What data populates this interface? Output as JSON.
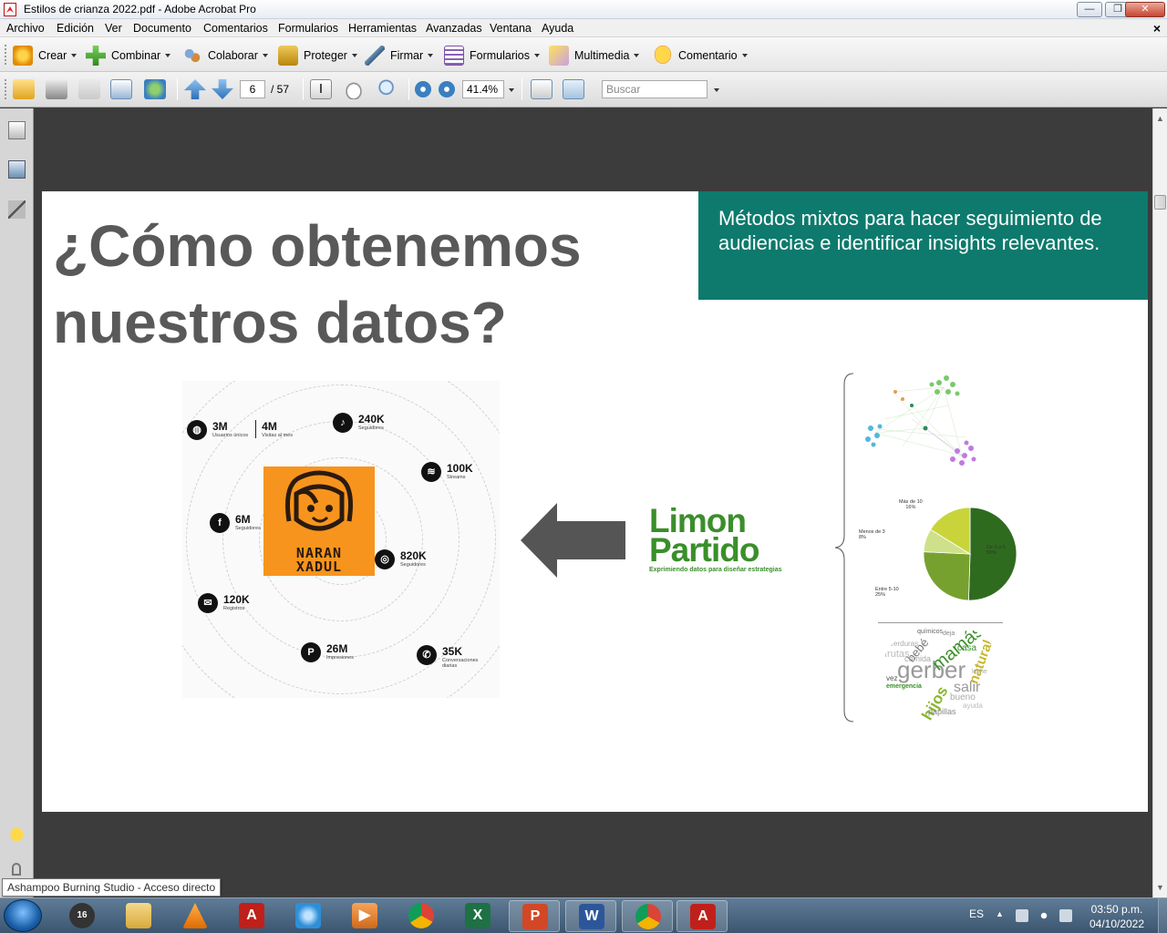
{
  "window": {
    "title": "Estilos de crianza 2022.pdf - Adobe Acrobat Pro",
    "controls": [
      "minimize",
      "restore",
      "close"
    ]
  },
  "menubar": {
    "items": [
      "Archivo",
      "Edición",
      "Ver",
      "Documento",
      "Comentarios",
      "Formularios",
      "Herramientas",
      "Avanzadas",
      "Ventana",
      "Ayuda"
    ],
    "close_glyph": "×"
  },
  "toolbar1": {
    "buttons": [
      {
        "label": "Crear",
        "icon": "create-icon"
      },
      {
        "label": "Combinar",
        "icon": "combine-icon"
      },
      {
        "label": "Colaborar",
        "icon": "collaborate-icon"
      },
      {
        "label": "Proteger",
        "icon": "lock-icon"
      },
      {
        "label": "Firmar",
        "icon": "pen-icon"
      },
      {
        "label": "Formularios",
        "icon": "form-icon"
      },
      {
        "label": "Multimedia",
        "icon": "multimedia-icon"
      },
      {
        "label": "Comentario",
        "icon": "comment-icon"
      }
    ]
  },
  "toolbar2": {
    "page_current": "6",
    "page_total": "/ 57",
    "zoom": "41.4%",
    "search_placeholder": "Buscar"
  },
  "slide": {
    "title": "¿Cómo obtenemos nuestros datos?",
    "callout": "Métodos mixtos para  hacer seguimiento de audiencias e identificar insights relevantes.",
    "brand_name_line1": "NARAN",
    "brand_name_line2": "XADUL",
    "stats": [
      {
        "icon": "globe-icon",
        "value": "3M",
        "label": "Usuarios únicos",
        "value2": "4M",
        "label2": "Visitas al mes"
      },
      {
        "icon": "tiktok-icon",
        "value": "240K",
        "label": "Seguidores"
      },
      {
        "icon": "spotify-icon",
        "value": "100K",
        "label": "Streams"
      },
      {
        "icon": "facebook-icon",
        "value": "6M",
        "label": "Seguidores"
      },
      {
        "icon": "instagram-icon",
        "value": "820K",
        "label": "Seguidores"
      },
      {
        "icon": "mail-icon",
        "value": "120K",
        "label": "Registros"
      },
      {
        "icon": "pinterest-icon",
        "value": "26M",
        "label": "Impresiones"
      },
      {
        "icon": "whatsapp-icon",
        "value": "35K",
        "label": "Conversaciones diarias"
      }
    ],
    "logo_line1": "Limon",
    "logo_line2": "Partido",
    "logo_tagline": "Exprimiendo datos para diseñar estrategias",
    "pie_labels": [
      {
        "text": "Más de 10\n16%"
      },
      {
        "text": "Menos de 3\n8%"
      },
      {
        "text": "De 3 a 5\n50%"
      },
      {
        "text": "Entre 5-10\n25%"
      }
    ],
    "pie_values": [
      50,
      25,
      8,
      16
    ],
    "pie_colors": [
      "#2f6b1f",
      "#77a12f",
      "#cfe08a",
      "#c8d43a"
    ],
    "word_cloud": [
      "gerber",
      "mamás",
      "hijos",
      "natural",
      "bebé",
      "salir",
      "casa",
      "comida",
      "frutas",
      "emergencia",
      "bueno",
      "papillas",
      "verduras",
      "químicos",
      "vez",
      "deja",
      "ayuda",
      "leche"
    ]
  },
  "tooltip": "Ashampoo Burning Studio - Acceso directo",
  "taskbar": {
    "apps": [
      {
        "name": "burning-studio",
        "color": "#444"
      },
      {
        "name": "file-explorer",
        "color": "#e0b44a"
      },
      {
        "name": "vlc",
        "color": "#f08000"
      },
      {
        "name": "acrobat",
        "color": "#c0201a"
      },
      {
        "name": "app-blue",
        "color": "#2e8fd8"
      },
      {
        "name": "media-player",
        "color": "#e07a2a"
      },
      {
        "name": "chrome",
        "color": "#4a90d9"
      },
      {
        "name": "excel",
        "color": "#1e7145"
      },
      {
        "name": "powerpoint",
        "color": "#d24726"
      },
      {
        "name": "word",
        "color": "#2b579a"
      },
      {
        "name": "chrome-active",
        "color": "#4a90d9"
      },
      {
        "name": "acrobat-active",
        "color": "#c0201a"
      }
    ],
    "language": "ES",
    "time": "03:50 p.m.",
    "date": "04/10/2022"
  }
}
